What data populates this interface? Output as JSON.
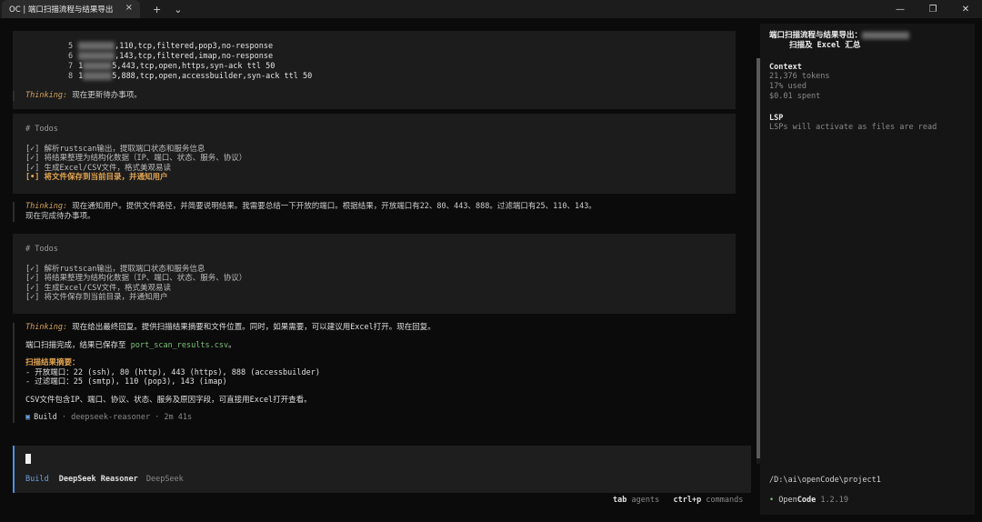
{
  "titlebar": {
    "tab_title": "OC | 端口扫描流程与结果导出",
    "close_glyph": "×",
    "new_tab_glyph": "+",
    "dropdown_glyph": "⌄",
    "min_glyph": "—",
    "max_glyph": "❐",
    "close_window_glyph": "✕"
  },
  "output": {
    "lines": [
      {
        "num": "5",
        "text": ",110,tcp,filtered,pop3,no-response"
      },
      {
        "num": "6",
        "text": ",143,tcp,filtered,imap,no-response"
      },
      {
        "num": "7",
        "text": ",443,tcp,open,https,syn-ack ttl 50"
      },
      {
        "num": "8",
        "text": ",888,tcp,open,accessbuilder,syn-ack ttl 50"
      }
    ],
    "line_prefixes": [
      "",
      "",
      "1",
      "1"
    ],
    "line_suffix_chars": [
      "",
      "",
      "5",
      "5"
    ]
  },
  "thinking_label": "Thinking:",
  "thinking1": "现在更新待办事项。",
  "todos1": {
    "head": "# Todos",
    "items": [
      "[✓] 解析rustscan输出，提取端口状态和服务信息",
      "[✓] 将结果整理为结构化数据（IP、端口、状态、服务、协议）",
      "[✓] 生成Excel/CSV文件，格式美观易读",
      "[•] 将文件保存到当前目录，并通知用户"
    ]
  },
  "thinking2": "现在通知用户。提供文件路径，并简要说明结果。我需要总结一下开放的端口。根据结果，开放端口有22、80、443、888。过滤端口有25、110、143。",
  "thinking2_cont": "现在完成待办事项。",
  "todos2": {
    "head": "# Todos",
    "items": [
      "[✓] 解析rustscan输出，提取端口状态和服务信息",
      "[✓] 将结果整理为结构化数据（IP、端口、状态、服务、协议）",
      "[✓] 生成Excel/CSV文件，格式美观易读",
      "[✓] 将文件保存到当前目录，并通知用户"
    ]
  },
  "thinking3": "现在给出最终回复。提供扫描结果摘要和文件位置。同时，如果需要，可以建议用Excel打开。现在回复。",
  "final": {
    "saved_prefix": "端口扫描完成，结果已保存至 ",
    "saved_path": "port_scan_results.csv",
    "saved_suffix": "。",
    "summary_title": "扫描结果摘要：",
    "open_ports": "- 开放端口：22 (ssh), 80 (http), 443 (https), 888 (accessbuilder)",
    "filtered_ports": "- 过滤端口：25 (smtp), 110 (pop3), 143 (imap)",
    "csv_note": "CSV文件包含IP、端口、协议、状态、服务及原因字段，可直接用Excel打开查看。",
    "build_icon": "▣",
    "build_name": "Build",
    "build_meta": " · deepseek-reasoner · 2m 41s"
  },
  "input": {
    "mode": "Build",
    "model": "DeepSeek Reasoner",
    "provider": "DeepSeek"
  },
  "hints": {
    "key1": "tab",
    "label1": " agents",
    "key2": "ctrl+p",
    "label2": " commands"
  },
  "sidebar": {
    "title_line1": "端口扫描流程与结果导出：",
    "title_line2": "扫描及 Excel 汇总",
    "context_head": "Context",
    "tokens": "21,376 tokens",
    "used": "17% used",
    "spent": "$0.01 spent",
    "lsp_head": "LSP",
    "lsp_text": "LSPs will activate as files are read",
    "path": "/D:\\ai\\openCode\\project1",
    "version_dot": "•",
    "version_open": " Open",
    "version_code": "Code",
    "version_num": " 1.2.19"
  }
}
